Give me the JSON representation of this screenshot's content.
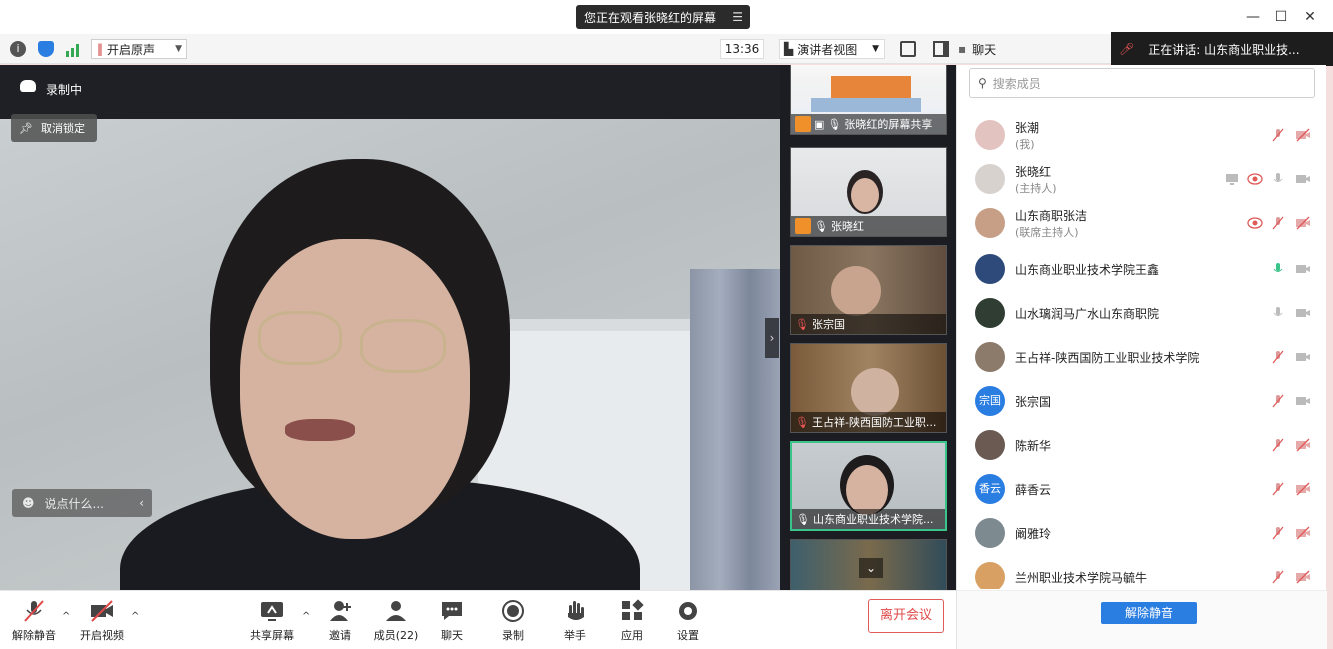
{
  "title_bar": {
    "watch_banner": "您正在观看张晓红的屏幕",
    "min_icon": "minimize-icon",
    "max_icon": "maximize-icon",
    "close_icon": "close-icon"
  },
  "toolbar": {
    "original_sound": "开启原声",
    "time": "13:36",
    "view_mode": "演讲者视图",
    "chat": "聊天",
    "speaking": "正在讲话: 山东商业职业技..."
  },
  "main_video": {
    "recording": "录制中",
    "unpin": "取消锁定",
    "say_placeholder": "说点什么..."
  },
  "thumbnails": [
    {
      "label": "张晓红的屏幕共享",
      "host": true
    },
    {
      "label": "张晓红",
      "host": true
    },
    {
      "label": "张宗国",
      "host": false
    },
    {
      "label": "王占祥-陕西国防工业职...",
      "host": false
    },
    {
      "label": "山东商业职业技术学院...",
      "host": false
    },
    {
      "label": "",
      "host": false
    }
  ],
  "panel": {
    "search_placeholder": "搜索成员",
    "unmute_all": "解除静音",
    "members": [
      {
        "name": "张潮",
        "role": "(我)",
        "avatar": "",
        "mic": "muted",
        "cam": "off"
      },
      {
        "name": "张晓红",
        "role": "(主持人)",
        "avatar": "",
        "mic": "idle",
        "cam": "on",
        "extras": [
          "screen-share-icon",
          "record-icon"
        ]
      },
      {
        "name": "山东商职张洁",
        "role": "(联席主持人)",
        "avatar": "",
        "mic": "muted",
        "cam": "off",
        "extras": [
          "record-icon"
        ]
      },
      {
        "name": "山东商业职业技术学院王鑫",
        "role": "",
        "avatar": "",
        "mic": "active",
        "cam": "on"
      },
      {
        "name": "山水璃润马广水山东商职院",
        "role": "",
        "avatar": "",
        "mic": "idle",
        "cam": "on"
      },
      {
        "name": "王占祥-陕西国防工业职业技术学院",
        "role": "",
        "avatar": "",
        "mic": "muted",
        "cam": "on"
      },
      {
        "name": "张宗国",
        "role": "",
        "avatar": "宗国",
        "mic": "muted",
        "cam": "on"
      },
      {
        "name": "陈新华",
        "role": "",
        "avatar": "",
        "mic": "muted",
        "cam": "off"
      },
      {
        "name": "薛香云",
        "role": "",
        "avatar": "香云",
        "mic": "muted",
        "cam": "off"
      },
      {
        "name": "阚雅玲",
        "role": "",
        "avatar": "",
        "mic": "muted",
        "cam": "off"
      },
      {
        "name": "兰州职业技术学院马毓牛",
        "role": "",
        "avatar": "",
        "mic": "muted",
        "cam": "off"
      }
    ]
  },
  "bottom_bar": {
    "unmute": "解除静音",
    "start_video": "开启视频",
    "share_screen": "共享屏幕",
    "invite": "邀请",
    "members": "成员(22)",
    "chat": "聊天",
    "record": "录制",
    "raise_hand": "举手",
    "apps": "应用",
    "settings": "设置",
    "leave": "离开会议"
  },
  "colors": {
    "accent": "#2a7de1",
    "leave": "#e04848",
    "mic_active": "#3ac48a",
    "host_badge": "#f0902b"
  }
}
